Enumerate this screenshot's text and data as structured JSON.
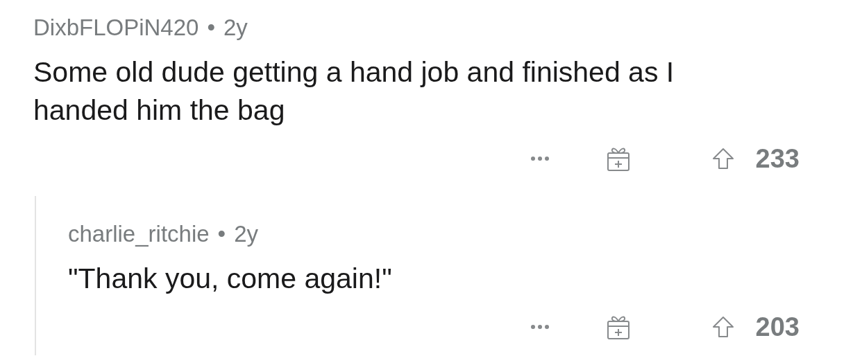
{
  "comments": [
    {
      "author": "DixbFLOPiN420",
      "separator": "•",
      "age": "2y",
      "body": "Some old dude getting a hand job and finished as I handed him the bag",
      "score": "233",
      "replies": [
        {
          "author": "charlie_ritchie",
          "separator": "•",
          "age": "2y",
          "body": "\"Thank you, come again!\"",
          "score": "203"
        }
      ]
    }
  ]
}
